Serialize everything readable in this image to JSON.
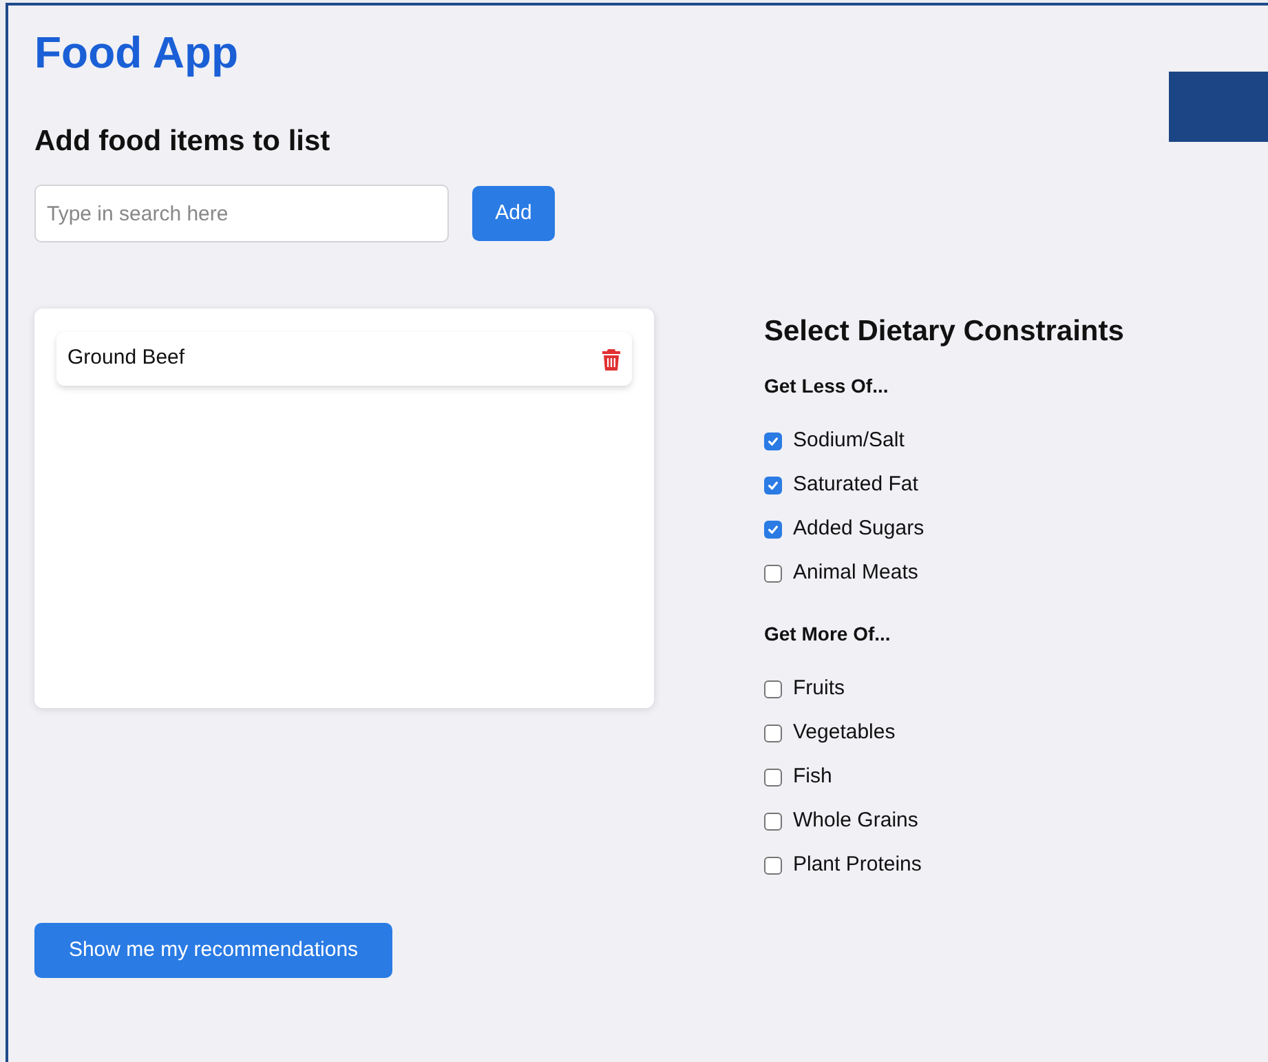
{
  "app_title": "Food App",
  "add_section": {
    "heading": "Add food items to list",
    "search": {
      "placeholder": "Type in search here"
    },
    "add_button": "Add"
  },
  "food_list": [
    {
      "name": "Ground Beef"
    }
  ],
  "dietary": {
    "heading": "Select Dietary Constraints",
    "groups": [
      {
        "title": "Get Less Of...",
        "options": [
          {
            "label": "Sodium/Salt",
            "checked": true
          },
          {
            "label": "Saturated Fat",
            "checked": true
          },
          {
            "label": "Added Sugars",
            "checked": true
          },
          {
            "label": "Animal Meats",
            "checked": false
          }
        ]
      },
      {
        "title": "Get More Of...",
        "options": [
          {
            "label": "Fruits",
            "checked": false
          },
          {
            "label": "Vegetables",
            "checked": false
          },
          {
            "label": "Fish",
            "checked": false
          },
          {
            "label": "Whole Grains",
            "checked": false
          },
          {
            "label": "Plant Proteins",
            "checked": false
          }
        ]
      }
    ]
  },
  "recommend_button": "Show me my recommendations"
}
